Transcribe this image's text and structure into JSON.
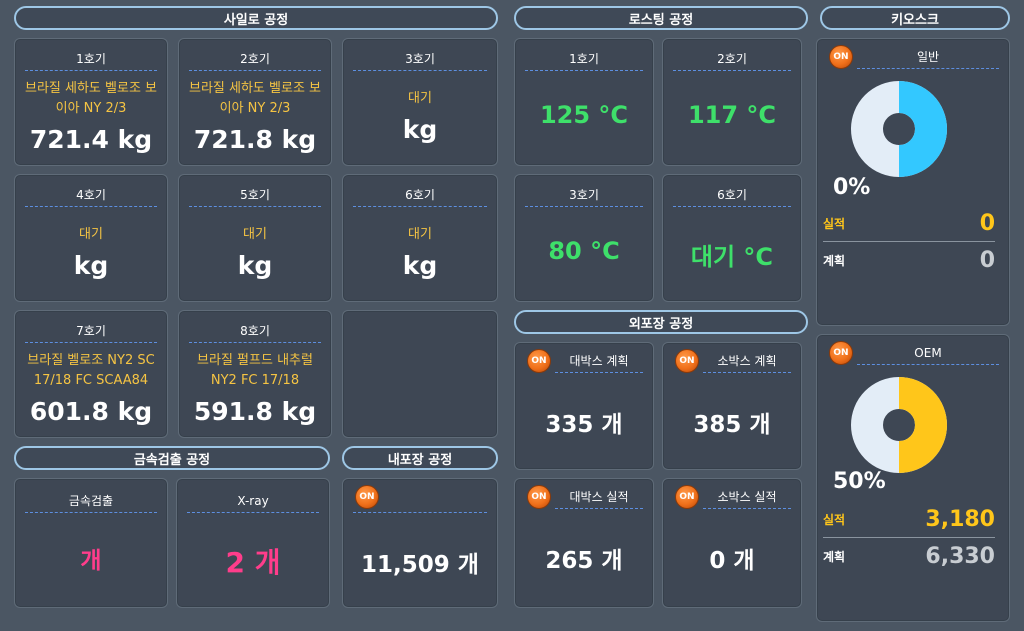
{
  "silo": {
    "header": "사일로 공정",
    "units": [
      {
        "title": "1호기",
        "product": "브라질 세하도 벨로조 보이아 NY 2/3",
        "weight": "721.4 kg"
      },
      {
        "title": "2호기",
        "product": "브라질 세하도 벨로조 보이아 NY 2/3",
        "weight": "721.8 kg"
      },
      {
        "title": "3호기",
        "product": "대기",
        "weight": "kg"
      },
      {
        "title": "4호기",
        "product": "대기",
        "weight": "kg"
      },
      {
        "title": "5호기",
        "product": "대기",
        "weight": "kg"
      },
      {
        "title": "6호기",
        "product": "대기",
        "weight": "kg"
      },
      {
        "title": "7호기",
        "product": "브라질 벨로조 NY2 SC 17/18 FC SCAA84",
        "weight": "601.8 kg"
      },
      {
        "title": "8호기",
        "product": "브라질 펄프드 내추럴 NY2 FC 17/18",
        "weight": "591.8 kg"
      }
    ]
  },
  "metal": {
    "header": "금속검출 공정",
    "items": [
      {
        "title": "금속검출",
        "value": "개"
      },
      {
        "title": "X-ray",
        "value": "2 개"
      }
    ]
  },
  "inner_pack": {
    "header": "내포장 공정",
    "on": "ON",
    "value": "11,509 개"
  },
  "roasting": {
    "header": "로스팅 공정",
    "units": [
      {
        "title": "1호기",
        "temp": "125 °C"
      },
      {
        "title": "2호기",
        "temp": "117 °C"
      },
      {
        "title": "3호기",
        "temp": "80 °C"
      },
      {
        "title": "6호기",
        "temp": "대기 °C"
      }
    ]
  },
  "outer_pack": {
    "header": "외포장 공정",
    "items": [
      {
        "on": "ON",
        "title": "대박스 계획",
        "value": "335 개"
      },
      {
        "on": "ON",
        "title": "소박스 계획",
        "value": "385 개"
      },
      {
        "on": "ON",
        "title": "대박스 실적",
        "value": "265 개"
      },
      {
        "on": "ON",
        "title": "소박스 실적",
        "value": "0 개"
      }
    ]
  },
  "kiosk": {
    "header": "키오스크",
    "panels": [
      {
        "on": "ON",
        "title": "일반",
        "percent": "0%",
        "fraction": 0.5,
        "fill_color": "#33c8ff",
        "actual_label": "실적",
        "actual_value": "0",
        "plan_label": "계획",
        "plan_value": "0"
      },
      {
        "on": "ON",
        "title": "OEM",
        "percent": "50%",
        "fraction": 0.5,
        "fill_color": "#ffc61a",
        "actual_label": "실적",
        "actual_value": "3,180",
        "plan_label": "계획",
        "plan_value": "6,330"
      }
    ]
  },
  "colors": {
    "product_text": "#f5c443",
    "temp_text": "#3ee06a",
    "metal_value": "#ff3d8b",
    "actual_value": "#ffc61a",
    "plan_value": "#c8cdd2",
    "donut_bg": "#e3edf7"
  }
}
